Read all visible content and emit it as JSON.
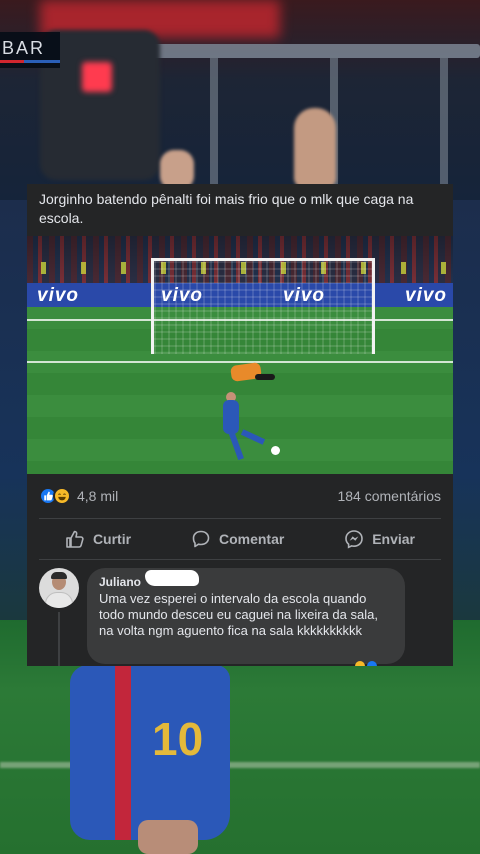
{
  "overlay": {
    "broadcast_tag": "BAR"
  },
  "post": {
    "caption": "Jorginho batendo pênalti foi mais frio que o mlk que caga na escola.",
    "image": {
      "board_texts": [
        "vivo",
        "vivo",
        "vivo",
        "vivo"
      ],
      "shirt_number": "10"
    },
    "reactions": {
      "types": [
        "like-icon",
        "haha-icon"
      ],
      "count": "4,8 mil"
    },
    "comments_count": "184 comentários",
    "actions": [
      {
        "label": "Curtir",
        "icon": "thumbs-up-icon"
      },
      {
        "label": "Comentar",
        "icon": "comment-icon"
      },
      {
        "label": "Enviar",
        "icon": "messenger-icon"
      }
    ]
  },
  "comment": {
    "author": "Juliano",
    "text": "Uma vez esperei o intervalo da escola quando todo mundo desceu eu caguei na lixeira da sala, na volta ngm aguento fica na sala kkkkkkkkkk"
  },
  "colors": {
    "card_bg": "#242526",
    "bubble_bg": "#3a3b3c",
    "like_blue": "#1877f2",
    "haha_yellow": "#f7b928",
    "text_primary": "#e4e6eb",
    "text_secondary": "#b0b3b8"
  }
}
